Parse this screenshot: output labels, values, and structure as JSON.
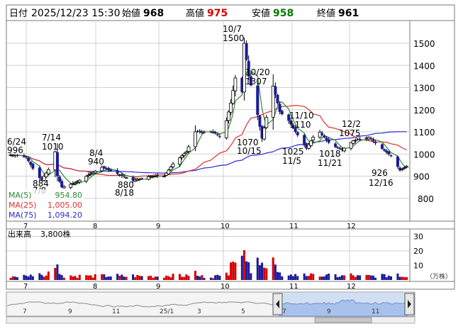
{
  "header": {
    "date_label": "日付",
    "datetime": "2025/12/23 15:30",
    "open_label": "始値",
    "open_value": "968",
    "high_label": "高値",
    "high_value": "975",
    "low_label": "安値",
    "low_value": "958",
    "close_label": "終値",
    "close_value": "961"
  },
  "legend": {
    "ma5": "MA(5)",
    "ma5_value": "954.80",
    "ma25": "MA(25)",
    "ma25_value": "1,005.00",
    "ma75": "MA(75)",
    "ma75_value": "1,094.20"
  },
  "volume_header": {
    "label": "出来高",
    "value": "3,800株"
  },
  "volume_unit": "（万株）",
  "navigator": {
    "labels": [
      "7",
      "9",
      "11",
      "25/1",
      "3",
      "5",
      "7",
      "9",
      "11"
    ]
  },
  "colors": {
    "up": "#d40000",
    "down": "#1a1a9a",
    "high": "#d40000",
    "low": "#007a00",
    "ma5": "#2e8b2e",
    "ma25": "#e03030",
    "ma75": "#2a2ad0",
    "grid": "#d0d0d0",
    "border": "#7a7a7a"
  },
  "chart_data": [
    {
      "type": "candlestick",
      "title": "",
      "x_tick_labels": [
        "7",
        "8",
        "9",
        "10",
        "11",
        "12"
      ],
      "y_ticks": [
        900,
        1000,
        1100,
        1200,
        1300,
        1400,
        1500
      ],
      "ylim": [
        800,
        1570
      ],
      "grid": true,
      "ohlc_anchor_points": [
        {
          "date": "6/24",
          "price": 996
        },
        {
          "date": "7/14",
          "price": 1010
        },
        {
          "date": "8/4",
          "price": 940
        },
        {
          "date": "8/18",
          "price": 880
        },
        {
          "date": "10/7",
          "price": 1500
        },
        {
          "date": "10/15",
          "price": 1070
        },
        {
          "date": "10/20",
          "price": 1307
        },
        {
          "date": "11/5",
          "price": 1025
        },
        {
          "date": "11/10",
          "price": 1110
        },
        {
          "date": "11/21",
          "price": 1018
        },
        {
          "date": "12/2",
          "price": 1075
        },
        {
          "date": "12/16",
          "price": 926
        }
      ],
      "annotations": [
        {
          "date": "6/24",
          "value": "996"
        },
        {
          "date": "7/14",
          "value": "1010"
        },
        {
          "date": "7/8",
          "value": "884"
        },
        {
          "date": "8/4",
          "value": "940"
        },
        {
          "date": "8/18",
          "value": "880"
        },
        {
          "date": "10/7",
          "value": "1500"
        },
        {
          "date": "10/20",
          "value": "1307"
        },
        {
          "date": "10/15",
          "value": "1070"
        },
        {
          "date": "11/10",
          "value": "1110"
        },
        {
          "date": "11/5",
          "value": "1025"
        },
        {
          "date": "11/21",
          "value": "1018"
        },
        {
          "date": "12/2",
          "value": "1075"
        },
        {
          "date": "12/16",
          "value": "926"
        }
      ],
      "moving_averages": [
        {
          "name": "MA(5)",
          "latest": 954.8
        },
        {
          "name": "MA(25)",
          "latest": 1005.0
        },
        {
          "name": "MA(75)",
          "latest": 1094.2
        }
      ]
    },
    {
      "type": "bar",
      "title": "出来高",
      "ylabel": "（万株）",
      "y_ticks": [
        10,
        20,
        30
      ],
      "ylim": [
        0,
        35
      ],
      "x_tick_labels": [
        "7",
        "8",
        "9",
        "10",
        "11",
        "12"
      ],
      "peak_value_approx": 19
    }
  ]
}
